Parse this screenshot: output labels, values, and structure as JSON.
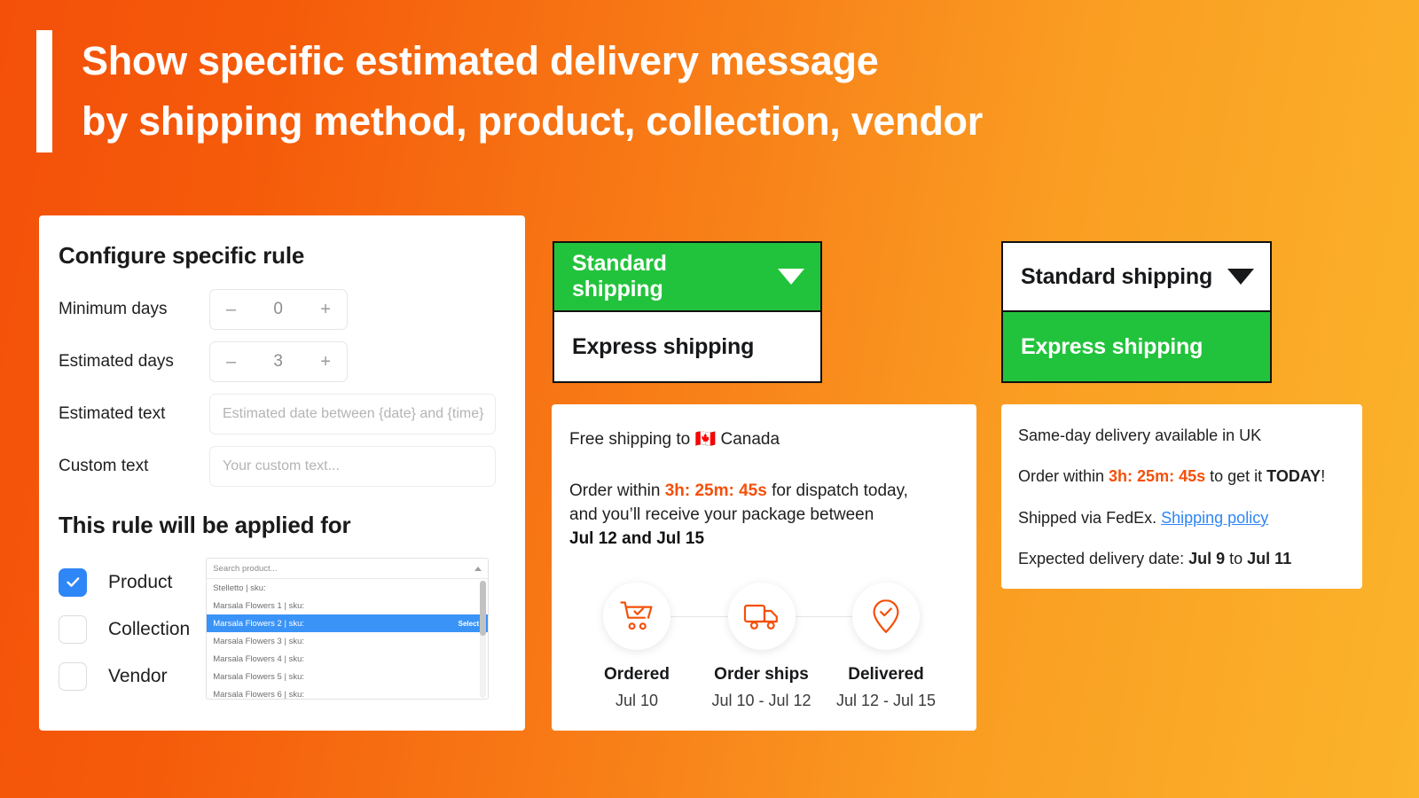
{
  "header": {
    "headline": "Show specific estimated delivery message\nby shipping method, product, collection, vendor"
  },
  "colors": {
    "bg_start": "#F4500A",
    "bg_end": "#FBB42B",
    "accent_orange": "#F4500A",
    "accent_green": "#22C33C",
    "accent_blue": "#2F86F6"
  },
  "left_card": {
    "title": "Configure specific rule",
    "fields": [
      {
        "label": "Minimum days",
        "type": "stepper",
        "minus": "–",
        "value": "0",
        "plus": "+"
      },
      {
        "label": "Estimated days",
        "type": "stepper",
        "minus": "–",
        "value": "3",
        "plus": "+"
      },
      {
        "label": "Estimated text",
        "type": "text",
        "value": "",
        "placeholder": "Estimated date between {date} and {time}"
      },
      {
        "label": "Custom text",
        "type": "text",
        "value": "",
        "placeholder": "Your custom text..."
      }
    ],
    "section_title": "This rule will be applied for",
    "checkboxes": [
      {
        "label": "Product",
        "checked": true
      },
      {
        "label": "Collection",
        "checked": false
      },
      {
        "label": "Vendor",
        "checked": false
      }
    ],
    "product_select": {
      "search_placeholder": "Search product...",
      "select_label": "Select",
      "items": [
        {
          "label": "Stelletto | sku:",
          "selected": false
        },
        {
          "label": "Marsala Flowers 1 | sku:",
          "selected": false
        },
        {
          "label": "Marsala Flowers 2 | sku:",
          "selected": true
        },
        {
          "label": "Marsala Flowers 3 | sku:",
          "selected": false
        },
        {
          "label": "Marsala Flowers 4 | sku:",
          "selected": false
        },
        {
          "label": "Marsala Flowers 5 | sku:",
          "selected": false
        },
        {
          "label": "Marsala Flowers 6 | sku:",
          "selected": false
        }
      ]
    }
  },
  "middle": {
    "dropdown": {
      "options": [
        {
          "label": "Standard shipping",
          "active": true
        },
        {
          "label": "Express shipping",
          "active": false
        }
      ]
    },
    "message": {
      "line1_prefix": "Free shipping to ",
      "line1_flag": "🇨🇦",
      "line1_suffix": " Canada",
      "line2_a": "Order within ",
      "line2_countdown": "3h: 25m: 45s",
      "line2_b": " for dispatch today,",
      "line3": "and you’ll receive your package between",
      "line4": "Jul 12 and Jul 15"
    },
    "timeline": [
      {
        "icon": "shopping-cart-check-icon",
        "name": "Ordered",
        "date": "Jul 10"
      },
      {
        "icon": "delivery-truck-icon",
        "name": "Order ships",
        "date": "Jul 10 - Jul 12"
      },
      {
        "icon": "location-pin-check-icon",
        "name": "Delivered",
        "date": "Jul 12 - Jul 15"
      }
    ]
  },
  "right": {
    "dropdown": {
      "options": [
        {
          "label": "Standard shipping",
          "active": false
        },
        {
          "label": "Express shipping",
          "active": true
        }
      ]
    },
    "message": {
      "line1": "Same-day delivery available in UK",
      "line2_a": "Order within ",
      "line2_countdown": "3h: 25m: 45s",
      "line2_b": " to get it ",
      "line2_bold": "TODAY",
      "line2_c": "!",
      "line3_a": "Shipped via FedEx. ",
      "line3_link": "Shipping policy",
      "line4_a": "Expected delivery date: ",
      "line4_b": "Jul 9",
      "line4_c": " to ",
      "line4_d": "Jul 11"
    }
  }
}
